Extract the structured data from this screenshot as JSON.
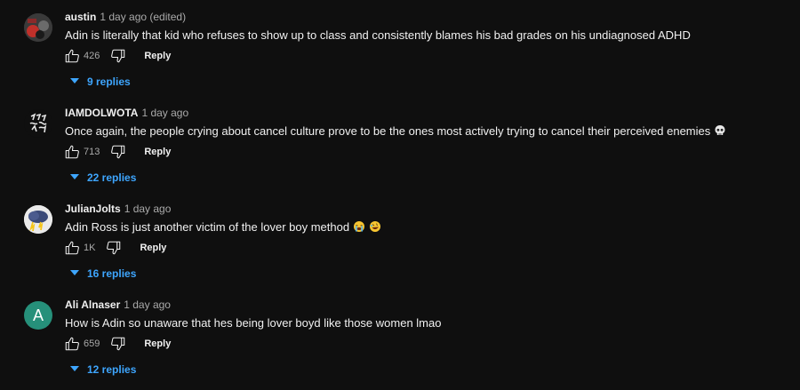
{
  "comments": [
    {
      "author": "austin",
      "time": "1 day ago (edited)",
      "text": "Adin is literally that kid who refuses to show up to class and consistently blames his bad grades on his undiagnosed ADHD",
      "likes": "426",
      "reply_label": "Reply",
      "replies_label": "9 replies"
    },
    {
      "author": "IAMDOLWOTA",
      "time": "1 day ago",
      "text": "Once again, the people crying about cancel culture prove to be the ones most actively trying to cancel their perceived enemies",
      "emoji": [
        "skull"
      ],
      "likes": "713",
      "reply_label": "Reply",
      "replies_label": "22 replies"
    },
    {
      "author": "JulianJolts",
      "time": "1 day ago",
      "text": "Adin Ross is just another victim of the lover boy method",
      "emoji": [
        "loudly-crying-face",
        "rofl-face"
      ],
      "likes": "1K",
      "reply_label": "Reply",
      "replies_label": "16 replies"
    },
    {
      "author": "Ali Alnaser",
      "avatar_letter": "A",
      "time": "1 day ago",
      "text": "How is Adin so unaware that hes being lover boyd like those women lmao",
      "likes": "659",
      "reply_label": "Reply",
      "replies_label": "12 replies"
    }
  ],
  "colors": {
    "background": "#0f0f0f",
    "text": "#f1f1f1",
    "muted": "#aaaaaa",
    "link": "#3ea6ff",
    "avatar_ali": "#26907a"
  }
}
